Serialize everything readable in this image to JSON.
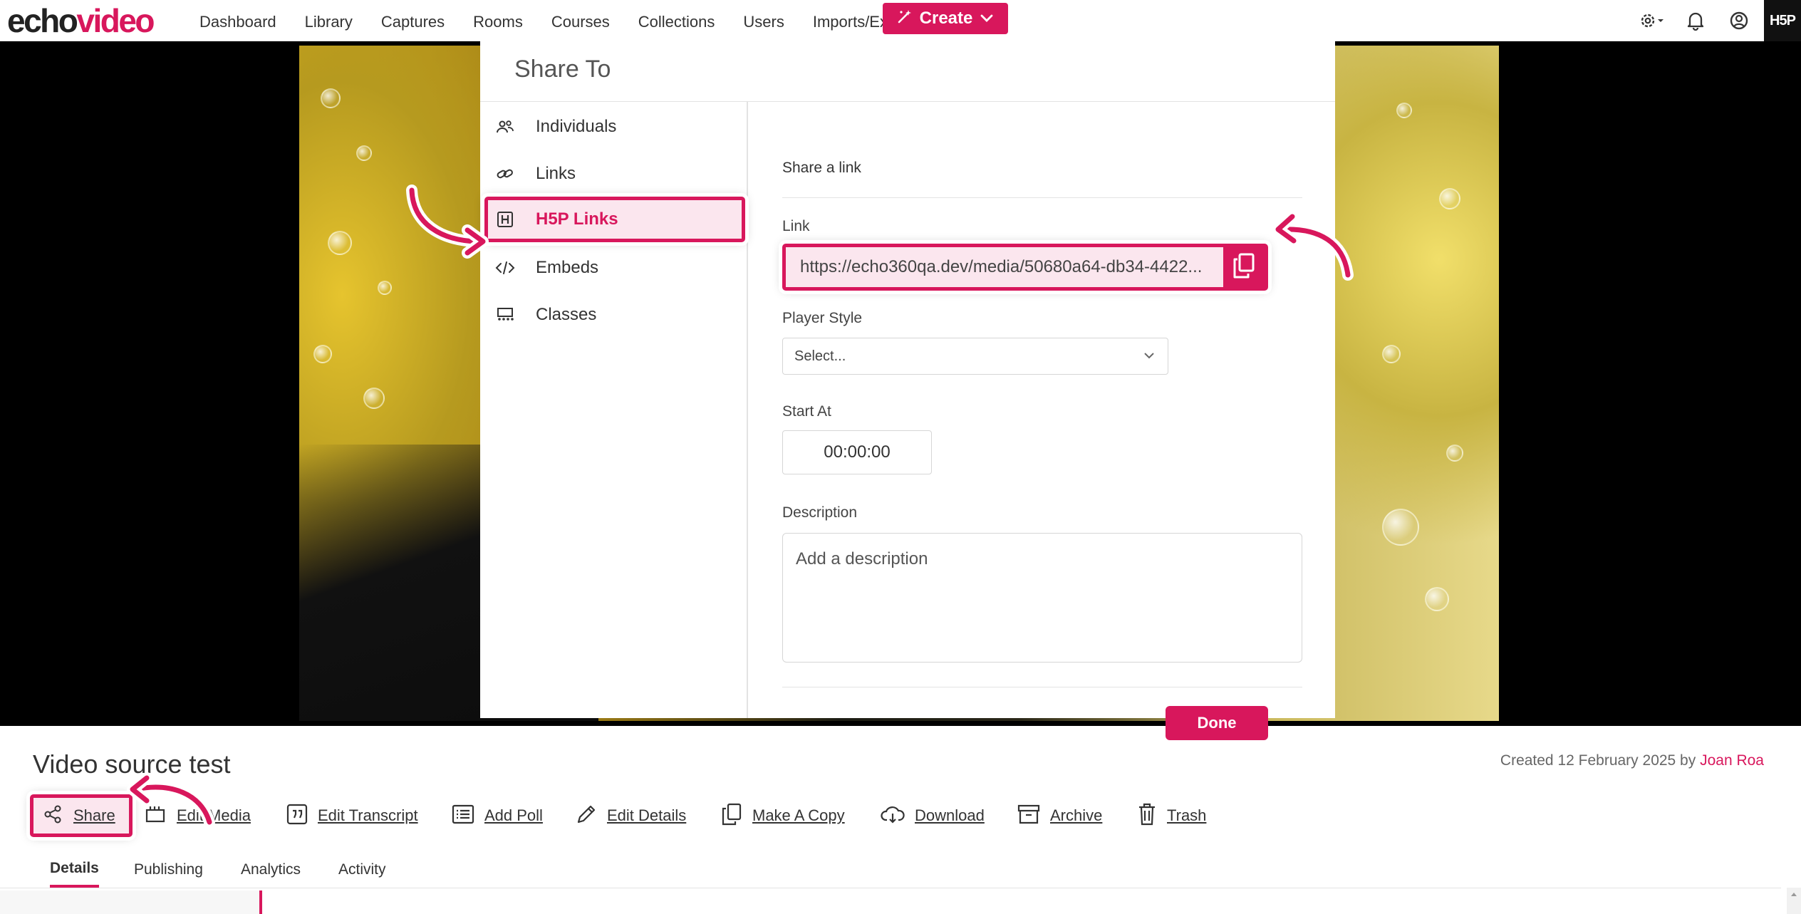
{
  "nav": {
    "logo_echo": "echo",
    "logo_video": "video",
    "items": [
      "Dashboard",
      "Library",
      "Captures",
      "Rooms",
      "Courses",
      "Collections",
      "Users",
      "Imports/Exports"
    ],
    "create_label": "Create",
    "h5p_badge": "H5P",
    "icons": [
      "gear-icon",
      "bell-icon",
      "user-circle-icon"
    ]
  },
  "modal": {
    "title": "Share To",
    "menu": [
      {
        "label": "Individuals",
        "icon": "users-icon",
        "active": false
      },
      {
        "label": "Links",
        "icon": "link-icon",
        "active": false
      },
      {
        "label": "H5P Links",
        "icon": "h5p-icon",
        "active": true
      },
      {
        "label": "Embeds",
        "icon": "code-icon",
        "active": false
      },
      {
        "label": "Classes",
        "icon": "classroom-icon",
        "active": false
      }
    ],
    "subtitle": "Share a link",
    "link_label": "Link",
    "link_value": "https://echo360qa.dev/media/50680a64-db34-4422...",
    "player_style_label": "Player Style",
    "player_style_value": "Select...",
    "start_at_label": "Start At",
    "start_at_value": "00:00:00",
    "description_label": "Description",
    "description_placeholder": "Add a description",
    "done_label": "Done"
  },
  "media": {
    "title": "Video source test",
    "created_prefix": "Created 12 February 2025 by",
    "created_author": "Joan Roa"
  },
  "actions": [
    {
      "label": "Share",
      "icon": "share-icon"
    },
    {
      "label": "Edit Media",
      "icon": "edit-media-icon"
    },
    {
      "label": "Edit Transcript",
      "icon": "quote-icon"
    },
    {
      "label": "Add Poll",
      "icon": "list-icon"
    },
    {
      "label": "Edit Details",
      "icon": "pencil-icon"
    },
    {
      "label": "Make A Copy",
      "icon": "copy-icon"
    },
    {
      "label": "Download",
      "icon": "download-icon"
    },
    {
      "label": "Archive",
      "icon": "archive-icon"
    },
    {
      "label": "Trash",
      "icon": "trash-icon"
    }
  ],
  "tabs": [
    {
      "label": "Details",
      "active": true
    },
    {
      "label": "Publishing",
      "active": false
    },
    {
      "label": "Analytics",
      "active": false
    },
    {
      "label": "Activity",
      "active": false
    }
  ],
  "colors": {
    "accent": "#d8175c",
    "highlight_bg": "#fbe6ee"
  }
}
